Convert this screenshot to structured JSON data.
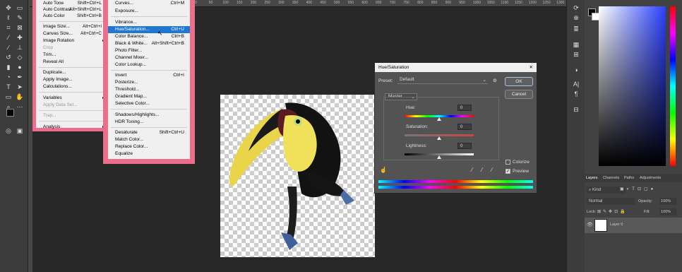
{
  "ruler_ticks": [
    "0",
    "50",
    "100",
    "150",
    "200",
    "250",
    "300",
    "350",
    "400",
    "450",
    "500",
    "550",
    "600",
    "650",
    "700",
    "750",
    "800",
    "850",
    "900",
    "950",
    "1000",
    "1050",
    "1100",
    "1150",
    "1200",
    "1250",
    "1300",
    "1350",
    "1400",
    "1450",
    "1500",
    "1550",
    "1600",
    "1650",
    "1700",
    "1750",
    "1800",
    "1850",
    "1900"
  ],
  "image_menu": {
    "items": [
      {
        "label": "Auto Tone",
        "shortcut": "Shift+Ctrl+L"
      },
      {
        "label": "Auto Contrast",
        "shortcut": "Alt+Shift+Ctrl+L"
      },
      {
        "label": "Auto Color",
        "shortcut": "Shift+Ctrl+B"
      },
      {
        "label": "Image Size...",
        "shortcut": "Alt+Ctrl+I"
      },
      {
        "label": "Canvas Size...",
        "shortcut": "Alt+Ctrl+C"
      },
      {
        "label": "Image Rotation",
        "shortcut": ""
      },
      {
        "label": "Crop",
        "shortcut": ""
      },
      {
        "label": "Trim...",
        "shortcut": ""
      },
      {
        "label": "Reveal All",
        "shortcut": ""
      },
      {
        "label": "Duplicate...",
        "shortcut": ""
      },
      {
        "label": "Apply Image...",
        "shortcut": ""
      },
      {
        "label": "Calculations...",
        "shortcut": ""
      },
      {
        "label": "Variables",
        "shortcut": ""
      },
      {
        "label": "Apply Data Set...",
        "shortcut": ""
      },
      {
        "label": "Trap...",
        "shortcut": ""
      },
      {
        "label": "Analysis",
        "shortcut": ""
      }
    ]
  },
  "adjust_menu": {
    "items": [
      {
        "label": "Curves...",
        "shortcut": "Ctrl+M"
      },
      {
        "label": "Exposure...",
        "shortcut": ""
      },
      {
        "label": "Vibrance...",
        "shortcut": ""
      },
      {
        "label": "Hue/Saturation...",
        "shortcut": "Ctrl+U"
      },
      {
        "label": "Color Balance...",
        "shortcut": "Ctrl+B"
      },
      {
        "label": "Black & White...",
        "shortcut": "Alt+Shift+Ctrl+B"
      },
      {
        "label": "Photo Filter...",
        "shortcut": ""
      },
      {
        "label": "Channel Mixer...",
        "shortcut": ""
      },
      {
        "label": "Color Lookup...",
        "shortcut": ""
      },
      {
        "label": "Invert",
        "shortcut": "Ctrl+I"
      },
      {
        "label": "Posterize...",
        "shortcut": ""
      },
      {
        "label": "Threshold...",
        "shortcut": ""
      },
      {
        "label": "Gradient Map...",
        "shortcut": ""
      },
      {
        "label": "Selective Color...",
        "shortcut": ""
      },
      {
        "label": "Shadows/Highlights...",
        "shortcut": ""
      },
      {
        "label": "HDR Toning...",
        "shortcut": ""
      },
      {
        "label": "Desaturate",
        "shortcut": "Shift+Ctrl+U"
      },
      {
        "label": "Match Color...",
        "shortcut": ""
      },
      {
        "label": "Replace Color...",
        "shortcut": ""
      },
      {
        "label": "Equalize",
        "shortcut": ""
      }
    ]
  },
  "dialog": {
    "title": "Hue/Saturation",
    "close": "✕",
    "preset_label": "Preset:",
    "preset_value": "Default",
    "channel": "Master",
    "hue_label": "Hue:",
    "hue_value": "0",
    "sat_label": "Saturation:",
    "sat_value": "0",
    "light_label": "Lightness:",
    "light_value": "0",
    "ok": "OK",
    "cancel": "Cancel",
    "colorize": "Colorize",
    "preview": "Preview",
    "preview_checked": true,
    "colorize_checked": false
  },
  "layers_panel": {
    "tabs": [
      "Layers",
      "Channels",
      "Paths",
      "Adjustments"
    ],
    "kind": "Kind",
    "blend": "Normal",
    "opacity_label": "Opacity:",
    "opacity": "100%",
    "lock_label": "Lock:",
    "fill_label": "Fill:",
    "fill": "100%",
    "layer_name": "Layer 0"
  }
}
